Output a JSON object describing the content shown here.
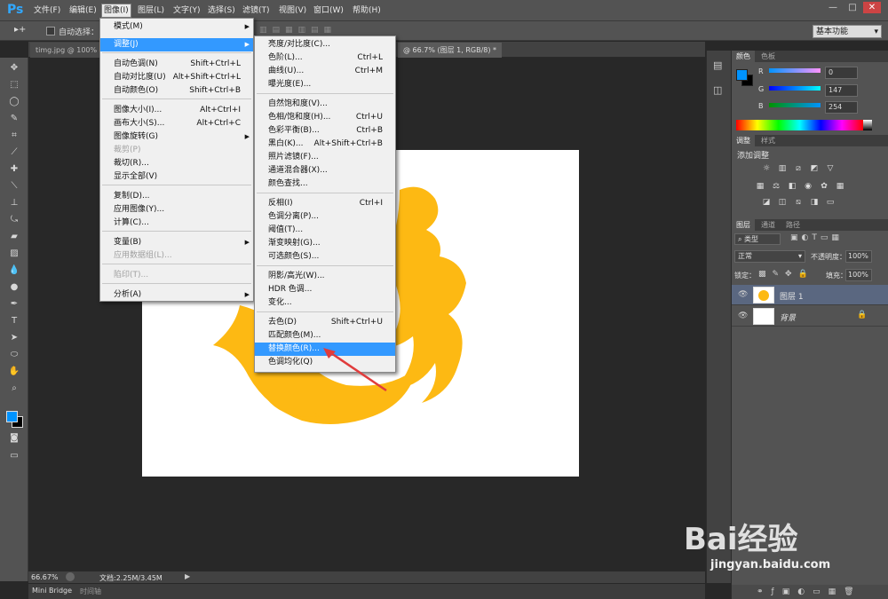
{
  "app_logo": "Ps",
  "menubar": {
    "items": [
      "文件(F)",
      "编辑(E)",
      "图像(I)",
      "图层(L)",
      "文字(Y)",
      "选择(S)",
      "滤镜(T)",
      "视图(V)",
      "窗口(W)",
      "帮助(H)"
    ],
    "active": "图像(I)"
  },
  "window_controls": [
    "—",
    "□",
    "✕"
  ],
  "optionsbar": {
    "auto_select": "自动选择：",
    "workspace": "基本功能"
  },
  "doc_tabs": [
    "timg.jpg @ 100%(...",
    "@ 66.7% (图层 1, RGB/8) *"
  ],
  "image_menu": {
    "items": [
      {
        "label": "模式(M)",
        "shortcut": "",
        "arrow": true,
        "disabled": false
      },
      {
        "label": "调整(J)",
        "shortcut": "",
        "arrow": true,
        "disabled": false,
        "highlight": true
      },
      {
        "label": "自动色调(N)",
        "shortcut": "Shift+Ctrl+L",
        "disabled": false
      },
      {
        "label": "自动对比度(U)",
        "shortcut": "Alt+Shift+Ctrl+L",
        "disabled": false
      },
      {
        "label": "自动颜色(O)",
        "shortcut": "Shift+Ctrl+B",
        "disabled": false
      },
      {
        "label": "图像大小(I)...",
        "shortcut": "Alt+Ctrl+I",
        "disabled": false
      },
      {
        "label": "画布大小(S)...",
        "shortcut": "Alt+Ctrl+C",
        "disabled": false
      },
      {
        "label": "图像旋转(G)",
        "shortcut": "",
        "arrow": true,
        "disabled": false
      },
      {
        "label": "裁剪(P)",
        "shortcut": "",
        "disabled": true
      },
      {
        "label": "裁切(R)...",
        "shortcut": "",
        "disabled": false
      },
      {
        "label": "显示全部(V)",
        "shortcut": "",
        "disabled": false
      },
      {
        "label": "复制(D)...",
        "shortcut": "",
        "disabled": false
      },
      {
        "label": "应用图像(Y)...",
        "shortcut": "",
        "disabled": false
      },
      {
        "label": "计算(C)...",
        "shortcut": "",
        "disabled": false
      },
      {
        "label": "变量(B)",
        "shortcut": "",
        "arrow": true,
        "disabled": false
      },
      {
        "label": "应用数据组(L)...",
        "shortcut": "",
        "disabled": true
      },
      {
        "label": "陷印(T)...",
        "shortcut": "",
        "disabled": true
      },
      {
        "label": "分析(A)",
        "shortcut": "",
        "arrow": true,
        "disabled": false
      }
    ]
  },
  "adjust_menu": {
    "items": [
      {
        "label": "亮度/对比度(C)...",
        "shortcut": ""
      },
      {
        "label": "色阶(L)...",
        "shortcut": "Ctrl+L"
      },
      {
        "label": "曲线(U)...",
        "shortcut": "Ctrl+M"
      },
      {
        "label": "曝光度(E)...",
        "shortcut": ""
      },
      {
        "label": "自然饱和度(V)...",
        "shortcut": ""
      },
      {
        "label": "色相/饱和度(H)...",
        "shortcut": "Ctrl+U"
      },
      {
        "label": "色彩平衡(B)...",
        "shortcut": "Ctrl+B"
      },
      {
        "label": "黑白(K)...",
        "shortcut": "Alt+Shift+Ctrl+B"
      },
      {
        "label": "照片滤镜(F)...",
        "shortcut": ""
      },
      {
        "label": "通道混合器(X)...",
        "shortcut": ""
      },
      {
        "label": "颜色查找...",
        "shortcut": ""
      },
      {
        "label": "反相(I)",
        "shortcut": "Ctrl+I"
      },
      {
        "label": "色调分离(P)...",
        "shortcut": ""
      },
      {
        "label": "阈值(T)...",
        "shortcut": ""
      },
      {
        "label": "渐变映射(G)...",
        "shortcut": ""
      },
      {
        "label": "可选颜色(S)...",
        "shortcut": ""
      },
      {
        "label": "阴影/高光(W)...",
        "shortcut": ""
      },
      {
        "label": "HDR 色调...",
        "shortcut": ""
      },
      {
        "label": "变化...",
        "shortcut": ""
      },
      {
        "label": "去色(D)",
        "shortcut": "Shift+Ctrl+U"
      },
      {
        "label": "匹配颜色(M)...",
        "shortcut": ""
      },
      {
        "label": "替换颜色(R)...",
        "shortcut": "",
        "highlight": true
      },
      {
        "label": "色调均化(Q)",
        "shortcut": ""
      }
    ]
  },
  "color_panel": {
    "tabs": [
      "颜色",
      "色板"
    ],
    "channels": [
      {
        "name": "R",
        "value": "0"
      },
      {
        "name": "G",
        "value": "147"
      },
      {
        "name": "B",
        "value": "254"
      }
    ],
    "fg_color": "#0093fe",
    "bg_color": "#000000"
  },
  "adjust_panel": {
    "tabs": [
      "调整",
      "样式"
    ],
    "title": "添加调整"
  },
  "layers_panel": {
    "tabs": [
      "图层",
      "通道",
      "路径"
    ],
    "filter": "类型",
    "blend_mode": "正常",
    "opacity_label": "不透明度：",
    "opacity": "100%",
    "lock_label": "锁定：",
    "fill_label": "填充：",
    "fill": "100%",
    "layers": [
      {
        "name": "图层 1",
        "selected": true
      },
      {
        "name": "背景",
        "selected": false
      }
    ]
  },
  "statusbar": {
    "zoom": "66.67%",
    "doc": "文档:2.25M/3.45M"
  },
  "bottom_tabs": [
    "Mini Bridge",
    "时间轴"
  ],
  "watermark": {
    "brand": "Bai经验",
    "url": "jingyan.baidu.com"
  },
  "colors": {
    "logo_yellow": "#fdb913",
    "menu_highlight": "#3399ff"
  }
}
